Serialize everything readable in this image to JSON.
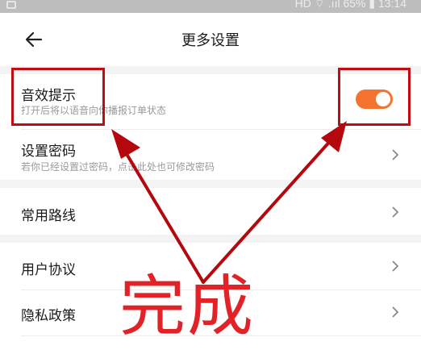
{
  "status_bar": {
    "right_text": "HD ⌔ .ııl 65% ▮ 13:14"
  },
  "header": {
    "back_icon": "arrow-left-icon",
    "title": "更多设置"
  },
  "settings": {
    "sound_tip": {
      "title": "音效提示",
      "subtitle": "打开后将以语音向你播报订单状态",
      "toggle_on": true,
      "toggle_color": "#f4742f"
    },
    "password": {
      "title": "设置密码",
      "subtitle": "若你已经设置过密码，点击此处也可修改密码"
    },
    "common_routes": {
      "title": "常用路线"
    },
    "user_agreement": {
      "title": "用户协议"
    },
    "privacy_policy": {
      "title": "隐私政策"
    }
  },
  "annotation": {
    "text": "完成",
    "color": "#e22227",
    "arrow_color": "#b4080e"
  }
}
